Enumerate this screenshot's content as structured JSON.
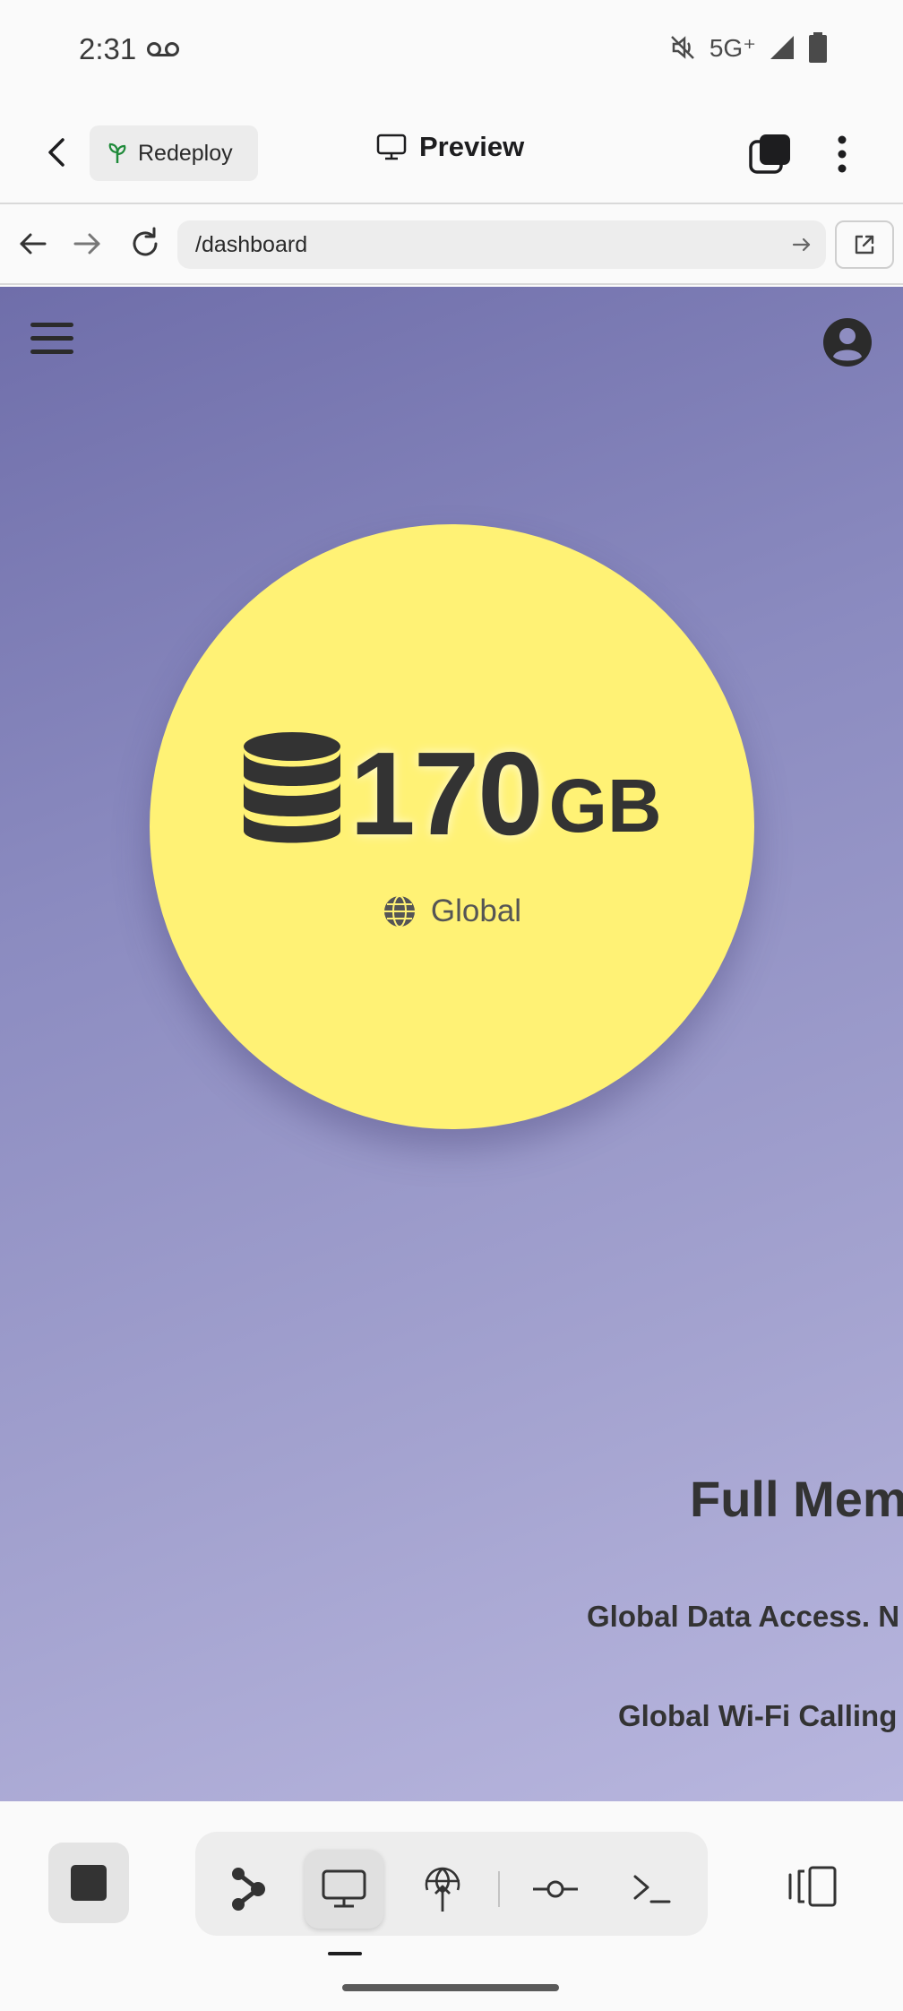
{
  "status_bar": {
    "time": "2:31",
    "network": "5G⁺"
  },
  "app_bar": {
    "redeploy_label": "Redeploy",
    "title": "Preview"
  },
  "browser": {
    "url": "/dashboard"
  },
  "page": {
    "usage_value": "170",
    "usage_unit": "GB",
    "region_label": "Global",
    "plan_title": "Full Mem",
    "features": [
      "Global Data Access. N",
      "Global Wi-Fi Calling"
    ]
  },
  "colors": {
    "accent_circle": "#fff275",
    "gradient_start": "#6f6eaa",
    "gradient_end": "#b8b6de",
    "text_dark": "#333333"
  },
  "icons": {
    "status": [
      "voicemail-icon",
      "mute-icon",
      "signal-icon",
      "battery-icon"
    ],
    "app_bar": [
      "back-icon",
      "sprout-icon",
      "monitor-icon",
      "tabs-icon",
      "more-vertical-icon"
    ],
    "browser": [
      "arrow-left-icon",
      "arrow-right-icon",
      "reload-icon",
      "go-arrow-icon",
      "open-external-icon"
    ],
    "page": [
      "hamburger-icon",
      "user-avatar-icon",
      "database-icon",
      "globe-icon"
    ],
    "toolbar": [
      "stop-icon",
      "share-graph-icon",
      "monitor-icon",
      "deploy-icon",
      "commit-icon",
      "terminal-icon",
      "split-view-icon"
    ]
  }
}
